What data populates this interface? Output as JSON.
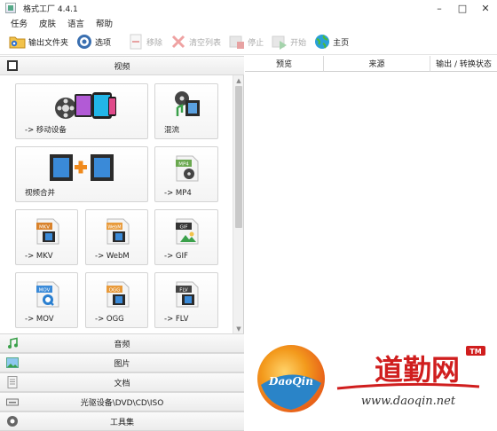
{
  "window": {
    "title": "格式工厂 4.4.1",
    "minimize": "–",
    "maximize": "□",
    "close": "✕"
  },
  "menu": [
    "任务",
    "皮肤",
    "语言",
    "帮助"
  ],
  "toolbar": {
    "output_folder": "输出文件夹",
    "options": "选项",
    "remove": "移除",
    "clear_list": "清空列表",
    "stop": "停止",
    "start": "开始",
    "home": "主页"
  },
  "categories": {
    "video": "视频",
    "audio": "音频",
    "image": "图片",
    "document": "文档",
    "optical": "光驱设备\\DVD\\CD\\ISO",
    "tools": "工具集"
  },
  "tiles": [
    {
      "label": "-> 移动设备",
      "icon": "mobile-device-icon"
    },
    {
      "label": "混流",
      "icon": "mux-icon"
    },
    {
      "label": "视频合并",
      "icon": "video-join-icon"
    },
    {
      "label": "-> MP4",
      "icon": "mp4-file-icon",
      "tag": "MP4"
    },
    {
      "label": "-> MKV",
      "icon": "mkv-file-icon",
      "tag": "MKV"
    },
    {
      "label": "-> WebM",
      "icon": "webm-file-icon",
      "tag": "WebM"
    },
    {
      "label": "-> GIF",
      "icon": "gif-file-icon",
      "tag": "GIF"
    },
    {
      "label": "-> MOV",
      "icon": "mov-file-icon",
      "tag": "MOV"
    },
    {
      "label": "-> OGG",
      "icon": "ogg-file-icon",
      "tag": "OGG"
    },
    {
      "label": "-> FLV",
      "icon": "flv-file-icon",
      "tag": "FLV"
    }
  ],
  "task_columns": [
    "预览",
    "来源",
    "输出 / 转换状态"
  ],
  "watermark": {
    "badge": "DaoQin",
    "brand": "道勤网",
    "tm": "TM",
    "url": "www.daoqin.net"
  },
  "colors": {
    "accent": "#3a6fb0",
    "film": "#2b2b2b",
    "orange": "#f08a1c",
    "green": "#3aa04a"
  }
}
